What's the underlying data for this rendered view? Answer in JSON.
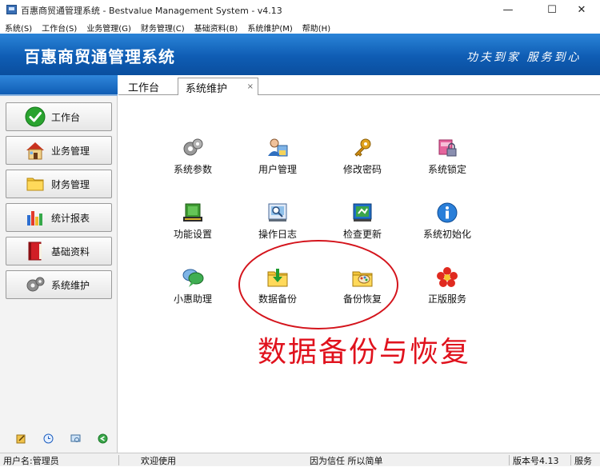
{
  "window": {
    "title": "百惠商贸通管理系统 - Bestvalue Management System  - v4.13",
    "min_glyph": "—",
    "max_glyph": "☐",
    "close_glyph": "✕"
  },
  "menu": [
    "系统(S)",
    "工作台(S)",
    "业务管理(G)",
    "财务管理(C)",
    "基础资料(B)",
    "系统维护(M)",
    "帮助(H)"
  ],
  "banner": {
    "app_name": "百惠商贸通管理系统",
    "slogan": "功夫到家 服务到心"
  },
  "sidebar": {
    "items": [
      {
        "label": "工作台",
        "icon": "checkmark-icon"
      },
      {
        "label": "业务管理",
        "icon": "house-icon"
      },
      {
        "label": "财务管理",
        "icon": "folder-icon"
      },
      {
        "label": "统计报表",
        "icon": "bar-chart-icon"
      },
      {
        "label": "基础资料",
        "icon": "book-icon"
      },
      {
        "label": "系统维护",
        "icon": "gear-icon"
      }
    ],
    "footer_icons": [
      "edit-icon",
      "clock-icon",
      "magnifier-icon",
      "back-arrow-icon"
    ]
  },
  "tabs": [
    {
      "label": "工作台"
    },
    {
      "label": "系统维护",
      "close": "×"
    }
  ],
  "tiles": [
    {
      "label": "系统参数",
      "icon": "gears-icon"
    },
    {
      "label": "用户管理",
      "icon": "users-icon"
    },
    {
      "label": "修改密码",
      "icon": "key-icon"
    },
    {
      "label": "系统锁定",
      "icon": "lock-icon"
    },
    {
      "label": "功能设置",
      "icon": "function-settings-icon"
    },
    {
      "label": "操作日志",
      "icon": "log-icon"
    },
    {
      "label": "检查更新",
      "icon": "update-icon"
    },
    {
      "label": "系统初始化",
      "icon": "info-icon"
    },
    {
      "label": "小惠助理",
      "icon": "chat-icon"
    },
    {
      "label": "数据备份",
      "icon": "backup-icon"
    },
    {
      "label": "备份恢复",
      "icon": "restore-icon"
    },
    {
      "label": "正版服务",
      "icon": "flower-icon"
    }
  ],
  "annotation": "数据备份与恢复",
  "status": {
    "user": "用户名:管理员",
    "welcome": "欢迎使用",
    "motto": "因为信任 所以简单",
    "version": "版本号4.13",
    "service": "服务"
  },
  "colors": {
    "banner": "#0f5db4",
    "annotation": "#e0121d",
    "ellipse": "#d4141c"
  }
}
